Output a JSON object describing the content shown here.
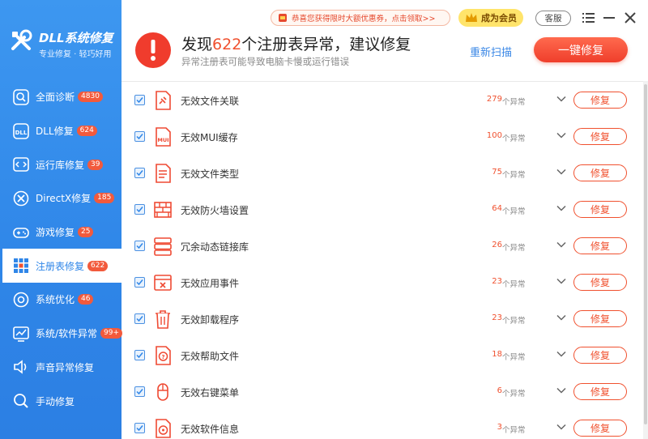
{
  "app": {
    "title": "DLL系统修复",
    "subtitle": "专业修复 · 轻巧好用"
  },
  "colors": {
    "sidebar_blue": "#2f86e8",
    "accent_red": "#f0512f",
    "badge_red": "#f25a3c",
    "link_blue": "#3a87e6",
    "vip_gold": "#ffe46b"
  },
  "sidebar": {
    "items": [
      {
        "label": "全面诊断",
        "badge": "4830",
        "icon": "search-icon"
      },
      {
        "label": "DLL修复",
        "badge": "624",
        "icon": "dll-icon"
      },
      {
        "label": "运行库修复",
        "badge": "39",
        "icon": "code-icon"
      },
      {
        "label": "DirectX修复",
        "badge": "185",
        "icon": "directx-icon"
      },
      {
        "label": "游戏修复",
        "badge": "25",
        "icon": "gamepad-icon"
      },
      {
        "label": "注册表修复",
        "badge": "622",
        "icon": "registry-grid-icon",
        "active": true
      },
      {
        "label": "系统优化",
        "badge": "46",
        "icon": "optimize-icon"
      },
      {
        "label": "系统/软件异常",
        "badge": "99+",
        "icon": "chart-icon"
      },
      {
        "label": "声音异常修复",
        "badge": "",
        "icon": "speaker-icon"
      },
      {
        "label": "手动修复",
        "badge": "",
        "icon": "magnifier-icon"
      }
    ]
  },
  "topbar": {
    "promo": "恭喜您获得限时大额优惠券，点击领取>>",
    "vip": "成为会员",
    "kefu": "客服"
  },
  "header": {
    "headline_prefix": "发现",
    "count": "622",
    "headline_suffix": "个注册表异常，建议修复",
    "subline": "异常注册表可能导致电脑卡慢或运行错误",
    "rescan": "重新扫描",
    "fix_all": "一键修复"
  },
  "list": {
    "unit": "个异常",
    "fix_label": "修复",
    "rows": [
      {
        "label": "无效文件关联",
        "count": "279",
        "icon": "file-link-icon"
      },
      {
        "label": "无效MUI缓存",
        "count": "100",
        "icon": "mui-file-icon"
      },
      {
        "label": "无效文件类型",
        "count": "75",
        "icon": "file-type-icon"
      },
      {
        "label": "无效防火墙设置",
        "count": "64",
        "icon": "firewall-icon"
      },
      {
        "label": "冗余动态链接库",
        "count": "26",
        "icon": "server-stack-icon"
      },
      {
        "label": "无效应用事件",
        "count": "23",
        "icon": "app-window-icon"
      },
      {
        "label": "无效卸载程序",
        "count": "23",
        "icon": "trash-icon"
      },
      {
        "label": "无效帮助文件",
        "count": "18",
        "icon": "help-file-icon"
      },
      {
        "label": "无效右键菜单",
        "count": "6",
        "icon": "mouse-icon"
      },
      {
        "label": "无效软件信息",
        "count": "3",
        "icon": "disc-icon"
      }
    ]
  }
}
